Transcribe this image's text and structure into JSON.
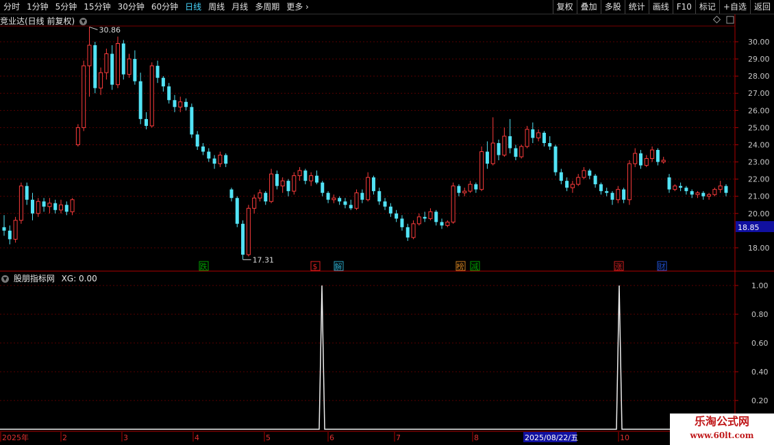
{
  "toolbar": {
    "periods": [
      "分时",
      "1分钟",
      "5分钟",
      "15分钟",
      "30分钟",
      "60分钟",
      "日线",
      "周线",
      "月线",
      "多周期",
      "更多 ›"
    ],
    "active_period": "日线",
    "actions": [
      "复权",
      "叠加",
      "多股",
      "统计",
      "画线",
      "F10",
      "标记",
      "+自选",
      "返回"
    ]
  },
  "main_chart": {
    "title": "竞业达(日线 前复权)",
    "y_ticks": [
      "30.00",
      "29.00",
      "28.00",
      "27.00",
      "26.00",
      "25.00",
      "24.00",
      "23.00",
      "22.00",
      "21.00",
      "20.00",
      "18.00"
    ],
    "ylim": [
      17.31,
      30.86
    ],
    "price_badge": "18.85",
    "high_label": "30.86",
    "low_label": "17.31",
    "event_marks": [
      {
        "label": "跌",
        "color": "#00a000"
      },
      {
        "label": "$",
        "color": "#e02020"
      },
      {
        "label": "解",
        "color": "#2aa8c8"
      },
      {
        "label": "榜",
        "color": "#d08020"
      },
      {
        "label": "减",
        "color": "#00a000"
      },
      {
        "label": "涨",
        "color": "#d02020"
      },
      {
        "label": "财",
        "color": "#2050d0"
      }
    ]
  },
  "indicator": {
    "title": "股朋指标网",
    "value_label": "XG: 0.00",
    "y_ticks": [
      "1.00",
      "0.80",
      "0.60",
      "0.40",
      "0.20"
    ]
  },
  "x_axis": {
    "labels": [
      "2025年",
      "2",
      "3",
      "4",
      "5",
      "6",
      "7",
      "8",
      "10"
    ],
    "cursor_date": "2025/08/22/五"
  },
  "watermark": {
    "line1": "乐淘公式网",
    "line2": "www.60lt.com"
  },
  "colors": {
    "up": "#ff3c3c",
    "down": "#52e3f5",
    "grid": "#5a0000",
    "axis": "#b00000"
  },
  "chart_data": {
    "type": "candlestick",
    "ylim": [
      17.31,
      30.86
    ],
    "ohlc": [
      [
        19.2,
        19.9,
        18.7,
        19.0
      ],
      [
        19.0,
        19.3,
        18.2,
        18.5
      ],
      [
        18.5,
        19.8,
        18.3,
        19.6
      ],
      [
        19.6,
        21.8,
        19.4,
        21.6
      ],
      [
        21.6,
        21.8,
        20.5,
        20.8
      ],
      [
        20.8,
        21.2,
        19.6,
        20.0
      ],
      [
        20.0,
        20.9,
        19.8,
        20.7
      ],
      [
        20.7,
        20.9,
        20.1,
        20.4
      ],
      [
        20.4,
        20.9,
        20.0,
        20.6
      ],
      [
        20.6,
        20.8,
        20.0,
        20.2
      ],
      [
        20.2,
        20.8,
        20.0,
        20.5
      ],
      [
        20.5,
        20.7,
        19.9,
        20.1
      ],
      [
        20.1,
        20.9,
        19.9,
        20.8
      ],
      [
        24.0,
        25.2,
        23.9,
        25.0
      ],
      [
        25.0,
        28.9,
        24.8,
        28.6
      ],
      [
        28.6,
        30.86,
        26.8,
        29.8
      ],
      [
        29.8,
        30.0,
        27.0,
        27.3
      ],
      [
        27.3,
        28.5,
        26.9,
        28.2
      ],
      [
        28.2,
        29.6,
        27.8,
        29.3
      ],
      [
        29.3,
        29.8,
        27.2,
        27.5
      ],
      [
        27.5,
        30.3,
        27.3,
        29.9
      ],
      [
        29.9,
        30.1,
        27.8,
        28.1
      ],
      [
        28.1,
        29.3,
        27.9,
        29.0
      ],
      [
        29.0,
        29.5,
        27.5,
        27.7
      ],
      [
        27.7,
        28.2,
        25.2,
        25.5
      ],
      [
        25.5,
        25.9,
        24.9,
        25.1
      ],
      [
        25.1,
        28.8,
        25.0,
        28.6
      ],
      [
        28.6,
        28.9,
        27.6,
        27.9
      ],
      [
        27.9,
        28.0,
        27.1,
        27.4
      ],
      [
        27.4,
        27.6,
        26.4,
        26.6
      ],
      [
        26.6,
        26.9,
        25.9,
        26.2
      ],
      [
        26.2,
        26.8,
        25.9,
        26.5
      ],
      [
        26.5,
        26.7,
        26.0,
        26.2
      ],
      [
        26.2,
        26.4,
        24.4,
        24.6
      ],
      [
        24.6,
        24.8,
        23.7,
        23.9
      ],
      [
        23.9,
        24.1,
        23.4,
        23.6
      ],
      [
        23.6,
        23.8,
        23.0,
        23.2
      ],
      [
        23.2,
        23.4,
        22.6,
        22.9
      ],
      [
        22.9,
        23.6,
        22.7,
        23.4
      ],
      [
        23.4,
        23.5,
        22.7,
        22.9
      ],
      [
        21.4,
        21.5,
        20.7,
        20.9
      ],
      [
        20.9,
        21.0,
        19.2,
        19.4
      ],
      [
        19.4,
        19.6,
        17.31,
        17.6
      ],
      [
        17.6,
        20.5,
        17.5,
        20.3
      ],
      [
        20.3,
        21.1,
        20.0,
        20.9
      ],
      [
        20.9,
        21.4,
        20.7,
        21.2
      ],
      [
        21.2,
        21.3,
        20.5,
        20.7
      ],
      [
        20.7,
        22.6,
        20.6,
        22.3
      ],
      [
        22.3,
        22.5,
        21.4,
        21.6
      ],
      [
        21.6,
        22.1,
        21.2,
        21.9
      ],
      [
        21.9,
        22.0,
        21.0,
        21.3
      ],
      [
        21.3,
        22.4,
        21.1,
        22.2
      ],
      [
        22.2,
        22.7,
        21.9,
        22.5
      ],
      [
        22.5,
        22.6,
        21.7,
        21.9
      ],
      [
        21.9,
        22.4,
        21.6,
        22.2
      ],
      [
        22.2,
        22.5,
        21.7,
        21.8
      ],
      [
        21.8,
        21.9,
        21.0,
        21.2
      ],
      [
        21.2,
        21.3,
        20.6,
        20.8
      ],
      [
        20.8,
        21.1,
        20.6,
        20.9
      ],
      [
        20.9,
        21.0,
        20.5,
        20.7
      ],
      [
        20.7,
        20.9,
        20.3,
        20.5
      ],
      [
        20.5,
        20.8,
        20.2,
        20.3
      ],
      [
        20.3,
        21.4,
        20.2,
        21.2
      ],
      [
        21.2,
        21.4,
        20.6,
        20.8
      ],
      [
        20.8,
        22.4,
        20.7,
        22.1
      ],
      [
        22.1,
        22.2,
        21.1,
        21.3
      ],
      [
        21.3,
        21.5,
        20.5,
        20.7
      ],
      [
        20.7,
        20.9,
        20.2,
        20.4
      ],
      [
        20.4,
        20.6,
        19.8,
        20.0
      ],
      [
        20.0,
        20.2,
        19.5,
        19.7
      ],
      [
        19.7,
        19.9,
        19.0,
        19.2
      ],
      [
        19.2,
        19.4,
        18.4,
        18.6
      ],
      [
        18.6,
        19.6,
        18.5,
        19.4
      ],
      [
        19.4,
        20.0,
        19.3,
        19.8
      ],
      [
        19.8,
        20.1,
        19.5,
        19.7
      ],
      [
        19.7,
        20.3,
        19.6,
        20.1
      ],
      [
        20.1,
        20.2,
        19.3,
        19.5
      ],
      [
        19.5,
        19.7,
        19.1,
        19.3
      ],
      [
        19.3,
        19.6,
        19.2,
        19.5
      ],
      [
        19.5,
        21.8,
        19.4,
        21.6
      ],
      [
        21.6,
        21.7,
        21.0,
        21.2
      ],
      [
        21.2,
        21.5,
        21.0,
        21.3
      ],
      [
        21.3,
        21.9,
        21.2,
        21.7
      ],
      [
        21.7,
        21.8,
        21.2,
        21.4
      ],
      [
        21.4,
        23.9,
        21.3,
        23.6
      ],
      [
        23.6,
        24.2,
        22.6,
        22.9
      ],
      [
        22.9,
        25.6,
        22.8,
        24.1
      ],
      [
        24.1,
        24.3,
        23.1,
        23.4
      ],
      [
        23.4,
        25.0,
        23.3,
        24.5
      ],
      [
        24.5,
        25.5,
        23.5,
        23.8
      ],
      [
        23.8,
        24.0,
        23.1,
        23.3
      ],
      [
        23.3,
        24.0,
        23.2,
        23.9
      ],
      [
        23.9,
        25.1,
        23.8,
        24.9
      ],
      [
        24.9,
        25.3,
        24.1,
        24.4
      ],
      [
        24.4,
        24.9,
        24.2,
        24.7
      ],
      [
        24.7,
        24.8,
        23.9,
        24.1
      ],
      [
        24.1,
        24.5,
        23.7,
        23.9
      ],
      [
        23.9,
        24.0,
        22.2,
        22.4
      ],
      [
        22.4,
        22.6,
        21.7,
        21.9
      ],
      [
        21.9,
        22.1,
        21.3,
        21.5
      ],
      [
        21.5,
        21.9,
        21.2,
        21.7
      ],
      [
        21.7,
        22.3,
        21.6,
        22.1
      ],
      [
        22.1,
        22.7,
        22.0,
        22.5
      ],
      [
        22.5,
        22.6,
        22.0,
        22.2
      ],
      [
        22.2,
        22.3,
        21.5,
        21.7
      ],
      [
        21.7,
        21.8,
        21.1,
        21.3
      ],
      [
        21.3,
        21.5,
        21.0,
        21.2
      ],
      [
        21.2,
        21.3,
        20.5,
        20.8
      ],
      [
        20.8,
        21.6,
        20.6,
        21.4
      ],
      [
        21.4,
        21.5,
        20.6,
        20.8
      ],
      [
        20.8,
        23.1,
        20.5,
        22.9
      ],
      [
        22.9,
        23.8,
        22.7,
        23.5
      ],
      [
        23.5,
        23.7,
        22.6,
        22.8
      ],
      [
        22.8,
        23.4,
        22.7,
        23.2
      ],
      [
        23.2,
        23.9,
        23.0,
        23.7
      ],
      [
        23.7,
        23.8,
        22.8,
        23.0
      ],
      [
        23.0,
        23.3,
        22.9,
        23.1
      ],
      [
        22.1,
        22.3,
        21.2,
        21.4
      ],
      [
        21.4,
        21.7,
        21.3,
        21.6
      ],
      [
        21.6,
        21.8,
        21.3,
        21.5
      ],
      [
        21.5,
        21.6,
        21.1,
        21.3
      ],
      [
        21.3,
        21.4,
        20.9,
        21.1
      ],
      [
        21.1,
        21.3,
        20.9,
        21.2
      ],
      [
        21.2,
        21.3,
        20.8,
        21.0
      ],
      [
        21.0,
        21.2,
        20.8,
        21.1
      ],
      [
        21.1,
        21.5,
        21.0,
        21.4
      ],
      [
        21.4,
        21.9,
        21.2,
        21.6
      ],
      [
        21.6,
        21.7,
        21.0,
        21.2
      ]
    ],
    "xg_signal": {
      "values": [
        0,
        1,
        0,
        1,
        0
      ],
      "ylim": [
        0,
        1
      ]
    },
    "xticks": [
      "2025年",
      "2",
      "3",
      "4",
      "5",
      "6",
      "7",
      "8",
      "10"
    ]
  }
}
